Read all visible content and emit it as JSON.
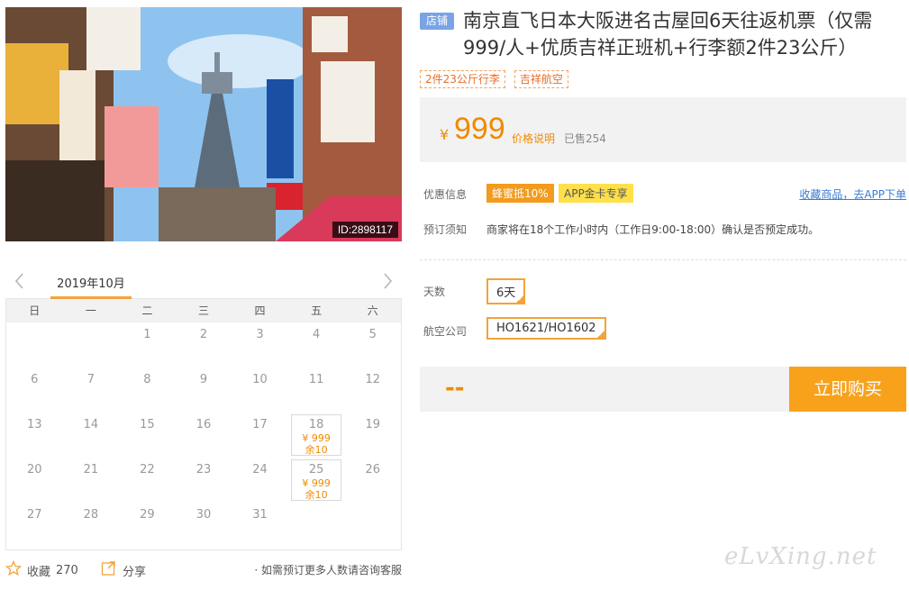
{
  "photo": {
    "image_id": "ID:2898117",
    "colors": {
      "sky": "#8ec3ef",
      "tower": "#5d6c7b",
      "sign_red": "#d9232e",
      "sign_blue": "#1b4fa3"
    }
  },
  "calendar": {
    "month_label": "2019年10月",
    "weekdays": [
      "日",
      "一",
      "二",
      "三",
      "四",
      "五",
      "六"
    ],
    "weeks": [
      [
        {
          "d": ""
        },
        {
          "d": ""
        },
        {
          "d": "1"
        },
        {
          "d": "2"
        },
        {
          "d": "3"
        },
        {
          "d": "4"
        },
        {
          "d": "5"
        }
      ],
      [
        {
          "d": "6"
        },
        {
          "d": "7"
        },
        {
          "d": "8"
        },
        {
          "d": "9"
        },
        {
          "d": "10"
        },
        {
          "d": "11"
        },
        {
          "d": "12"
        }
      ],
      [
        {
          "d": "13"
        },
        {
          "d": "14"
        },
        {
          "d": "15"
        },
        {
          "d": "16"
        },
        {
          "d": "17"
        },
        {
          "d": "18",
          "price": "¥ 999",
          "stock": "余10"
        },
        {
          "d": "19"
        }
      ],
      [
        {
          "d": "20"
        },
        {
          "d": "21"
        },
        {
          "d": "22"
        },
        {
          "d": "23"
        },
        {
          "d": "24"
        },
        {
          "d": "25",
          "price": "¥ 999",
          "stock": "余10"
        },
        {
          "d": "26"
        }
      ],
      [
        {
          "d": "27"
        },
        {
          "d": "28"
        },
        {
          "d": "29"
        },
        {
          "d": "30"
        },
        {
          "d": "31"
        },
        {
          "d": ""
        },
        {
          "d": ""
        }
      ]
    ]
  },
  "actions": {
    "favorite_label": "收藏",
    "favorite_count": "270",
    "share_label": "分享",
    "note": "· 如需预订更多人数请咨询客服"
  },
  "product": {
    "shop_tag": "店铺",
    "title": "南京直飞日本大阪进名古屋回6天往返机票（仅需999/人+优质吉祥正班机+行李额2件23公斤）",
    "tags": [
      "2件23公斤行李",
      "吉祥航空"
    ],
    "currency": "¥",
    "price": "999",
    "price_explain": "价格说明",
    "sold": "已售254"
  },
  "info": {
    "promo_label": "优惠信息",
    "badges": [
      "蜂蜜抵10%",
      "APP金卡专享"
    ],
    "fav_link": "收藏商品，去APP下单",
    "notice_label": "预订须知",
    "notice_text": "商家将在18个工作小时内（工作日9:00-18:00）确认是否预定成功。"
  },
  "options": {
    "days_label": "天数",
    "days_value": "6天",
    "airline_label": "航空公司",
    "airline_value": "HO1621/HO1602"
  },
  "buy": {
    "total": "--",
    "button_label": "立即购买"
  },
  "watermark": "eLvXing.net",
  "accent_color": "#f8a21c"
}
